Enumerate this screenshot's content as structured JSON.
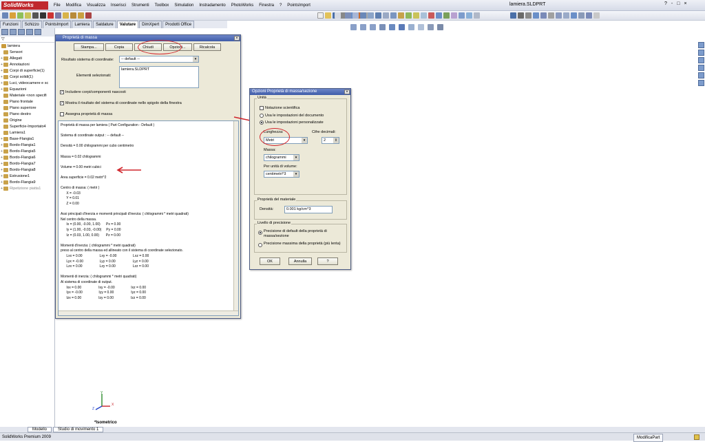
{
  "app": {
    "logo": "SolidWorks",
    "document_title": "lamiera.SLDPRT",
    "menus": [
      "File",
      "Modifica",
      "Visualizza",
      "Inserisci",
      "Strumenti",
      "Toolbox",
      "Simulation",
      "Instradamento",
      "PhotoWorks",
      "Finestra",
      "?",
      "PointsImport"
    ],
    "window_controls": [
      "?",
      "-",
      "□",
      "×"
    ]
  },
  "command_tabs": [
    "Funzioni",
    "Schizzo",
    "PointsImport",
    "Lamiera",
    "Saldature",
    "Valutare",
    "DimXpert",
    "Prodotti Office"
  ],
  "feature_tree": {
    "root": "lamiera",
    "items": [
      {
        "label": "Sensori",
        "exp": ""
      },
      {
        "label": "Allegati",
        "exp": "+"
      },
      {
        "label": "Annotazioni",
        "exp": "+"
      },
      {
        "label": "Corpi di superficie(1)",
        "exp": "+"
      },
      {
        "label": "Corpi solidi(1)",
        "exp": "+"
      },
      {
        "label": "Luci, videocamere e sc",
        "exp": "+"
      },
      {
        "label": "Equazioni",
        "exp": "+"
      },
      {
        "label": "Materiale <non specifi",
        "exp": ""
      },
      {
        "label": "Piano frontale",
        "exp": ""
      },
      {
        "label": "Piano superiore",
        "exp": ""
      },
      {
        "label": "Piano destro",
        "exp": ""
      },
      {
        "label": "Origine",
        "exp": ""
      },
      {
        "label": "Superficie-Importato4",
        "exp": ""
      },
      {
        "label": "Lamiera1",
        "exp": ""
      },
      {
        "label": "Base-Flangia1",
        "exp": "+"
      },
      {
        "label": "Bordo-Flangia1",
        "exp": "+"
      },
      {
        "label": "Bordo-Flangia5",
        "exp": "+"
      },
      {
        "label": "Bordo-Flangia6",
        "exp": "+"
      },
      {
        "label": "Bordo-Flangia7",
        "exp": "+"
      },
      {
        "label": "Bordo-Flangia8",
        "exp": "+"
      },
      {
        "label": "Estrusione1",
        "exp": "+"
      },
      {
        "label": "Bordo-Flangia9",
        "exp": "+"
      },
      {
        "label": "Ripetizione piatta1",
        "exp": "+"
      }
    ]
  },
  "mass_dialog": {
    "title": "Proprietà di massa",
    "buttons": [
      "Stampa...",
      "Copia",
      "Chiudi",
      "Opzioni...",
      "Ricalcola"
    ],
    "coord_label": "Risultato sistema di coordinate:",
    "coord_value": "-- default --",
    "selected_label": "Elementi selezionati:",
    "selected_value": "lamiera.SLDPRT",
    "chk_hidden": "Includere corpi/componenti nascosti",
    "chk_show": "Mostra il risultato del sistema di coordinate nello spigolo della finestra",
    "chk_assign": "Assegna proprietà di massa",
    "results": [
      "Proprietà di massa per lamiera ( Part Configuration - Default )",
      "",
      "Sistema di coordinate output : -- default --",
      "",
      "Densità = 0.00 chilogrammi per cubo centimetro",
      "",
      "Massa = 0.02 chilogrammi",
      "",
      "Volume = 0.00 metri cubici",
      "",
      "Area superficie = 0.02 metri^2",
      "",
      "Centro di massa: ( metri )",
      "      X = -0.03",
      "      Y = 0.01",
      "      Z = 0.00",
      "",
      "Assi principali d'inerzia e momenti principali d'inerzia: ( chilogrammi * metri quadrati)",
      "Nel centro della massa.",
      "      Ix = (0.00, -0.00, 1.00)      Px = 0.00",
      "      Iy = (1.00, -0.03, -0.00)     Py = 0.00",
      "      Iz = (0.03, 1.00, 0.00)       Pz = 0.00",
      "",
      "Momenti d'inerzia: ( chilogrammi * metri quadrati)",
      "preso al centro della massa ed allineato con il sistema di coordinate selezionato.",
      "      Lxx = 0.00                  Lxy = -0.00                 Lxz = 0.00",
      "      Lyx = -0.00                 Lyy = 0.00                  Lyz = 0.00",
      "      Lzx = 0.00                  Lzy = 0.00                  Lzz = 0.00",
      "",
      "Momenti di inerzia: ( chilogrammi * metri quadrati)",
      "Al sistema di coordinate di output.",
      "      Ixx = 0.00                  Ixy = -0.00                 Ixz = 0.00",
      "      Iyx = -0.00                 Iyy = 0.00                  Iyz = 0.00",
      "      Izx = 0.00                  Izy = 0.00                  Izz = 0.00"
    ]
  },
  "options_dialog": {
    "title": "Opzioni Proprietà di massa/sezione",
    "units_group": "Unità",
    "sci_notation": "Notazione scientifica",
    "use_doc": "Usa le impostazioni del documento",
    "use_custom": "Usa le impostazioni personalizzate",
    "length_label": "Lunghezza:",
    "length_value": "Metri",
    "decimals_label": "Cifre decimali:",
    "decimals_value": "2",
    "mass_label": "Massa:",
    "mass_value": "chilogrammi",
    "volume_label": "Per unità di volume:",
    "volume_value": "centimetri^3",
    "material_group": "Proprietà del materiale",
    "density_label": "Densità:",
    "density_value": "0.001 kg/cm^3",
    "precision_group": "Livello di precisione",
    "precision_default": "Precisione di default della proprietà di massa/sezione",
    "precision_max": "Precisione massima della proprietà (più lenta)",
    "ok": "OK",
    "cancel": "Annulla",
    "help": "?"
  },
  "viewport": {
    "view_label": "*Isometrico",
    "axis_x": "X",
    "axis_y": "Y",
    "axis_z": "Z"
  },
  "bottom_tabs": [
    "Modello",
    "Studio di movimento 1"
  ],
  "status": {
    "left": "SolidWorks Premium 2009",
    "right": "ModificaPart"
  },
  "colors": {
    "annotation_red": "#d0232a",
    "title_blue": "#3f5ca8"
  }
}
